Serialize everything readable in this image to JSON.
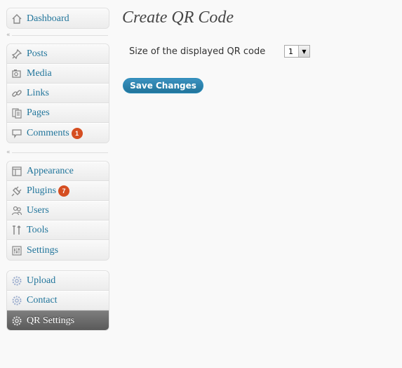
{
  "sidebar": {
    "group1": [
      {
        "label": "Dashboard",
        "icon": "dashboard-icon"
      }
    ],
    "group2": [
      {
        "label": "Posts",
        "icon": "pushpin-icon"
      },
      {
        "label": "Media",
        "icon": "media-icon"
      },
      {
        "label": "Links",
        "icon": "chain-link-icon"
      },
      {
        "label": "Pages",
        "icon": "pages-icon"
      },
      {
        "label": "Comments",
        "icon": "speech-bubble-icon",
        "badge": "1"
      }
    ],
    "group3": [
      {
        "label": "Appearance",
        "icon": "appearance-icon"
      },
      {
        "label": "Plugins",
        "icon": "plug-icon",
        "badge": "7"
      },
      {
        "label": "Users",
        "icon": "users-icon"
      },
      {
        "label": "Tools",
        "icon": "tools-icon"
      },
      {
        "label": "Settings",
        "icon": "settings-icon"
      }
    ],
    "group4": [
      {
        "label": "Upload",
        "icon": "gear-icon"
      },
      {
        "label": "Contact",
        "icon": "gear-icon"
      },
      {
        "label": "QR Settings",
        "icon": "gear-icon",
        "current": true
      }
    ]
  },
  "main": {
    "title": "Create QR Code",
    "field_label": "Size of the displayed QR code",
    "size_value": "1",
    "save_label": "Save Changes"
  },
  "colors": {
    "link": "#21759b",
    "badge": "#d54e21",
    "current_bg": "#636363",
    "button": "#21759b"
  }
}
